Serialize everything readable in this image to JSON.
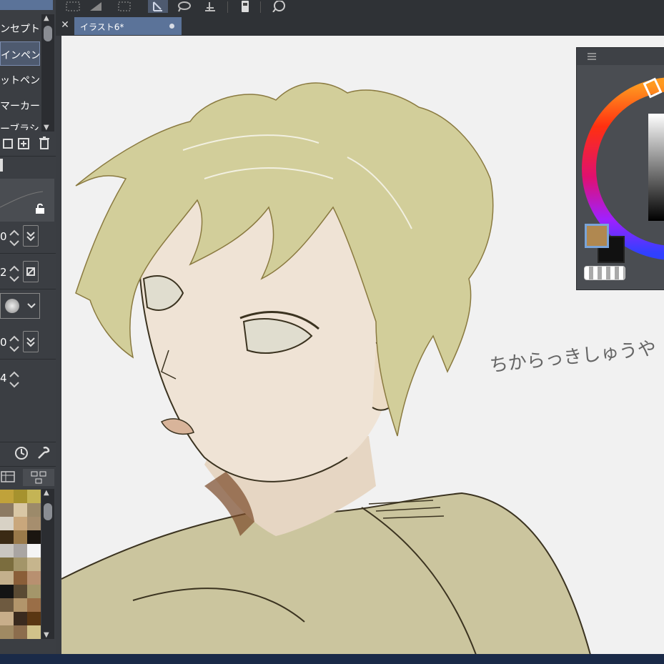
{
  "tab": {
    "title": "イラスト6*"
  },
  "brushes": [
    {
      "label": "ンセプト",
      "selected": false
    },
    {
      "label": "インペン",
      "selected": true
    },
    {
      "label": "ットペン",
      "selected": false
    },
    {
      "label": "マーカー",
      "selected": false
    },
    {
      "label": "ーブラシ",
      "selected": false
    }
  ],
  "properties": [
    {
      "value": "0"
    },
    {
      "value": "2"
    },
    {
      "value": "0"
    },
    {
      "value": "4"
    }
  ],
  "canvas": {
    "signature": "ちからっきしゅうや"
  },
  "colors": {
    "main_color": "#b08850",
    "sub_color": "#000000",
    "accent": "#5b7399",
    "canvas_bg": "#f1f1f1"
  },
  "palette": [
    [
      "#c0a23a",
      "#a6922e",
      "#c4b455"
    ],
    [
      "#8c7a62",
      "#d9c7a5",
      "#9c8a6a"
    ],
    [
      "#d8d2c5",
      "#c9a77c",
      "#a68e6e"
    ],
    [
      "#3a2a14",
      "#9a7a4a",
      "#1a1510"
    ],
    [
      "#c9c6c0",
      "#a9a5a2",
      "#f4f4f4"
    ],
    [
      "#7b6d3e",
      "#a39569",
      "#c6b58d"
    ],
    [
      "#c4b08c",
      "#8a5e38",
      "#b89070"
    ],
    [
      "#141414",
      "#5a4a33",
      "#a4966a"
    ],
    [
      "#6e5a40",
      "#b2956b",
      "#9a6e47"
    ],
    [
      "#c8ae8a",
      "#3a2a1e",
      "#5a3612"
    ],
    [
      "#a08a63",
      "#8c6d4d",
      "#d1c28a"
    ]
  ]
}
